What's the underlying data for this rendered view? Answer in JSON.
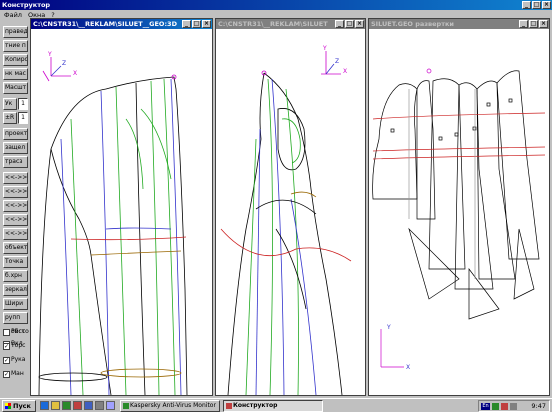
{
  "app": {
    "title": "Конструктор",
    "menu": [
      "Файл",
      "Окна",
      "?"
    ]
  },
  "toolbar": {
    "buttons": [
      "правед",
      "тние п",
      "Копиро",
      "нк мас",
      "Масшт"
    ],
    "scale_label": "Ук",
    "scale_value": "1",
    "step_label": "±R",
    "step_value": "1",
    "buttons2": [
      "проект",
      "защел",
      "трасз",
      "<<->>",
      "<<->>",
      "<<->>",
      "<<->>",
      "<<->>",
      "объект",
      "Точка",
      "б.хрн",
      "зеркал",
      "Шири",
      "рупп"
    ],
    "checkboxes": [
      {
        "label": "Рисс",
        "checked": true
      },
      {
        "label": "Вкл",
        "checked": false
      },
      {
        "label": "обсто",
        "checked": false
      },
      {
        "label": "Торс",
        "checked": true
      },
      {
        "label": "Рука",
        "checked": true
      },
      {
        "label": "Ман",
        "checked": true
      }
    ]
  },
  "windows": {
    "w1": {
      "title": "C:\\CNSTR31\\__REKLAM\\SILUET__GEO:3D"
    },
    "w2": {
      "title": "C:\\CNSTR31\\__REKLAM\\SILUET"
    },
    "w3": {
      "title": "SILUET.GEO развертки"
    }
  },
  "axes": {
    "x": "X",
    "y": "Y",
    "z": "Z"
  },
  "taskbar": {
    "start": "Пуск",
    "tasks": [
      {
        "label": "Kaspersky Anti-Virus Monitor",
        "pressed": false
      },
      {
        "label": "Конструктор",
        "pressed": true
      }
    ],
    "tray_lang": "En",
    "clock": "9:47"
  },
  "colors": {
    "title_active": "#000080",
    "outline": "#000000",
    "green_lines": "#22aa22",
    "blue_lines": "#3333cc",
    "red_lines": "#cc2222",
    "magenta": "#cc00cc"
  }
}
